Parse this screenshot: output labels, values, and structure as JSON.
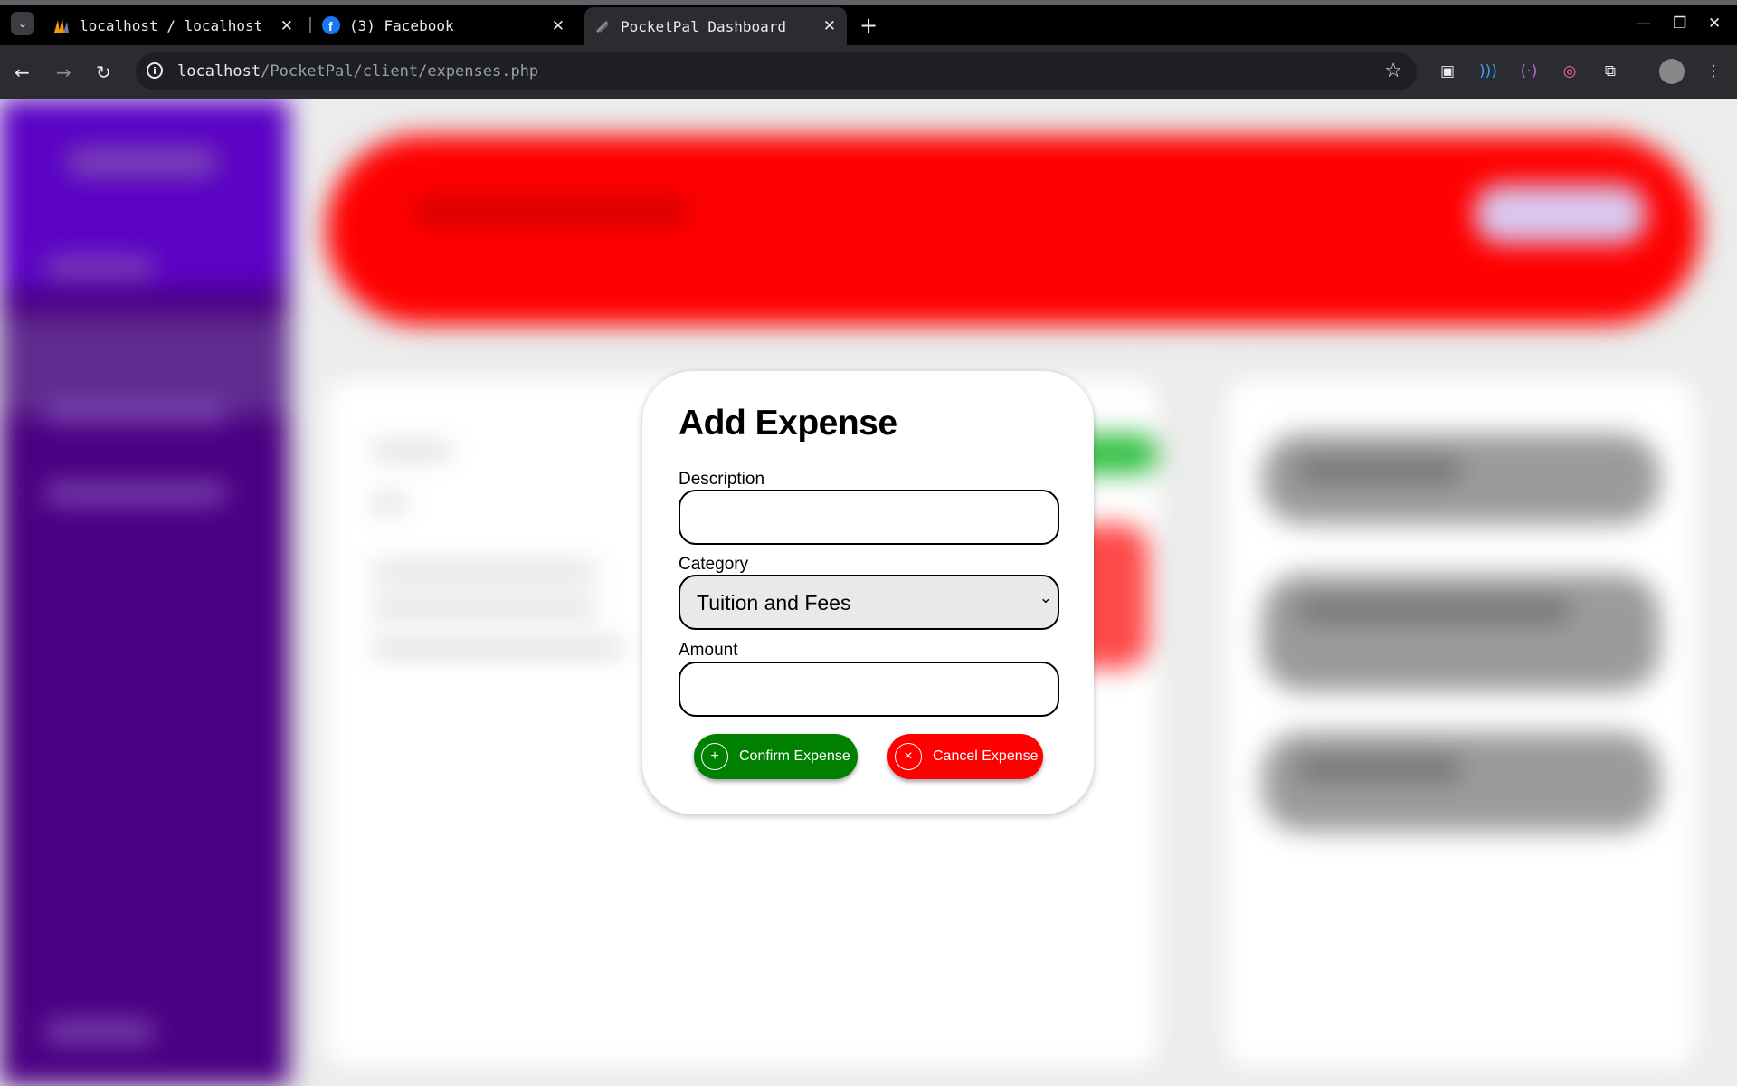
{
  "browser": {
    "tabs": [
      {
        "title": "localhost / localhost",
        "icon": "phpmyadmin-icon"
      },
      {
        "title": "(3) Facebook",
        "icon": "facebook-icon"
      },
      {
        "title": "PocketPal Dashboard",
        "icon": "pocketpal-icon",
        "active": true
      }
    ],
    "url_host": "localhost",
    "url_path": "/PocketPal/client/expenses.php"
  },
  "modal": {
    "title": "Add Expense",
    "description_label": "Description",
    "description_value": "",
    "category_label": "Category",
    "category_selected": "Tuition and Fees",
    "amount_label": "Amount",
    "amount_value": "",
    "confirm_label": "Confirm Expense",
    "cancel_label": "Cancel Expense",
    "confirm_color": "#008000",
    "cancel_color": "#ff0000"
  },
  "background": {
    "sidebar_color": "#4b0082",
    "header_color": "#ff0000",
    "blurred": true
  }
}
